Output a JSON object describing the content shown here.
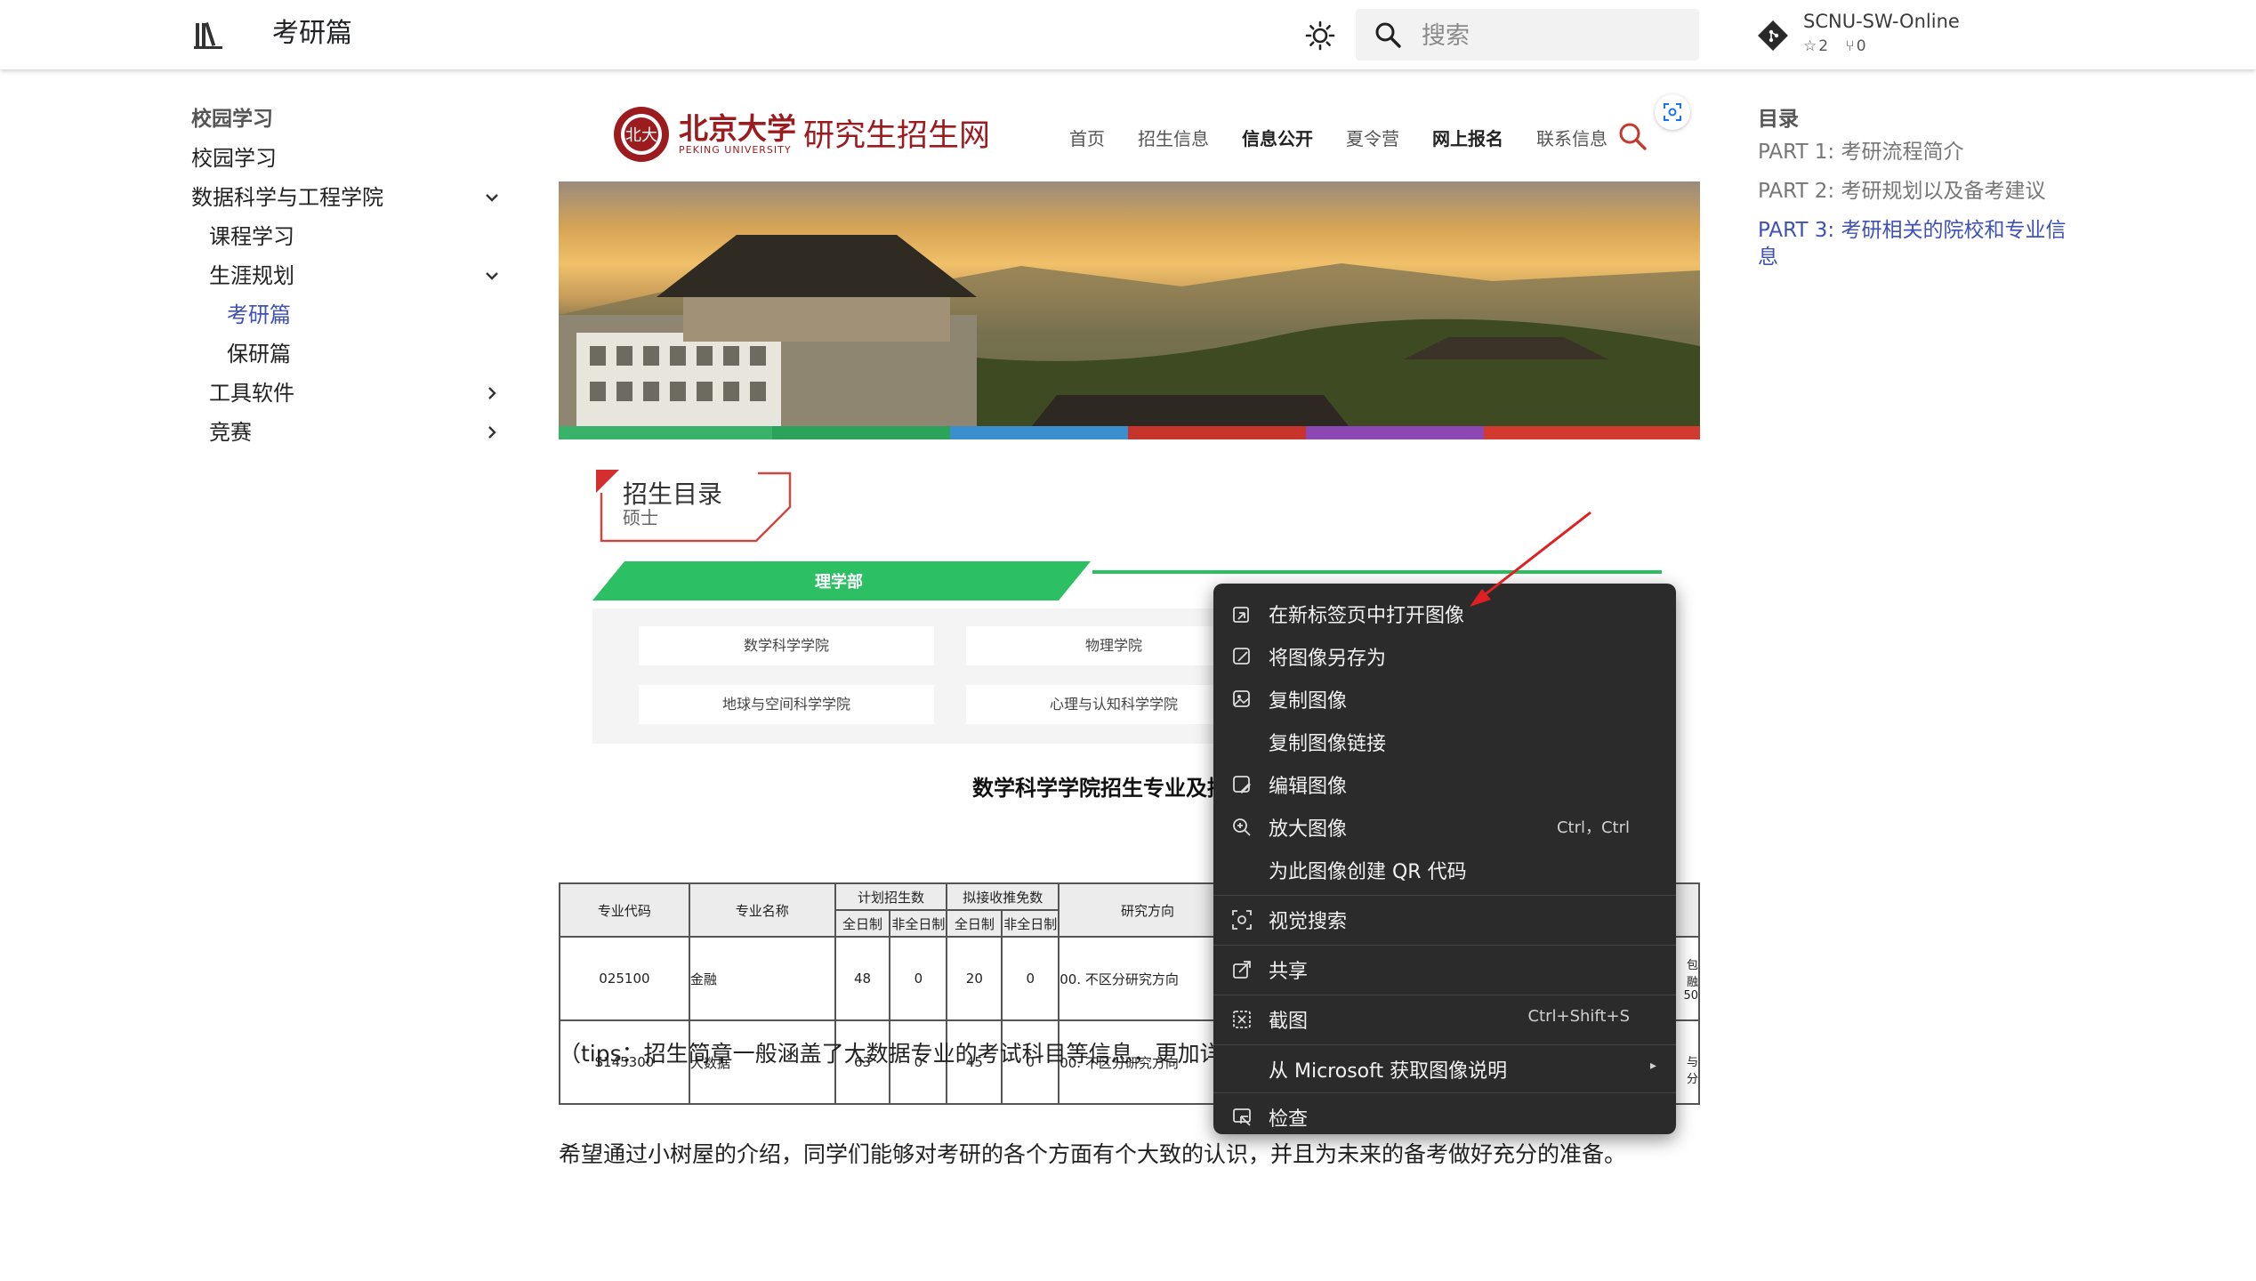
{
  "header": {
    "logo_icon": "library-books-icon",
    "title": "考研篇",
    "theme_icon": "brightness-icon",
    "search_icon": "magnify-icon",
    "search_placeholder": "搜索",
    "repo": {
      "icon": "git-diamond-icon",
      "name": "SCNU-SW-Online",
      "stars": "2",
      "forks": "0"
    }
  },
  "nav": {
    "heading": "校园学习",
    "items": [
      {
        "label": "校园学习"
      },
      {
        "label": "数据科学与工程学院"
      },
      {
        "label": "课程学习"
      },
      {
        "label": "生涯规划"
      },
      {
        "label": "考研篇"
      },
      {
        "label": "保研篇"
      },
      {
        "label": "工具软件"
      },
      {
        "label": "竞赛"
      }
    ]
  },
  "content": {
    "pku": {
      "name": "北京大学",
      "name_en": "PEKING UNIVERSITY",
      "site_title": "研究生招生网",
      "nav": [
        "首页",
        "招生信息",
        "信息公开",
        "夏令营",
        "网上报名",
        "联系信息"
      ]
    },
    "catalog": {
      "title": "招生目录",
      "subtitle": "硕士",
      "department": "理学部",
      "schools": [
        "数学科学学院",
        "物理学院",
        "地球与空间科学学院",
        "心理与认知科学学院"
      ]
    },
    "table": {
      "title": "数学科学学院招生专业及拟",
      "headers": [
        "专业代码",
        "专业名称",
        "计划招生数",
        "拟接收推免数",
        "研究方向"
      ],
      "subheaders": [
        "全日制",
        "非全日制",
        "全日制",
        "非全日制"
      ],
      "rows": [
        [
          "025100",
          "金融",
          "48",
          "0",
          "20",
          "0",
          "00. 不区分研究方向"
        ],
        [
          "S145300",
          "大数据",
          "63",
          "0",
          "45",
          "0",
          "00. 不区分研究方向"
        ]
      ],
      "edge_text_1": "包\n融\n50",
      "edge_text_2": "\n与\n分"
    },
    "tips": "（tips：招生简章一般涵盖了大数据专业的考试科目等信息，更加详细的信息可以搜集学长学姐们的上岸经验贴！）",
    "closing": "希望通过小树屋的介绍，同学们能够对考研的各个方面有个大致的认识，并且为未来的备考做好充分的准备。"
  },
  "context_menu": {
    "items": [
      {
        "label": "在新标签页中打开图像",
        "icon": "open-new-tab-icon"
      },
      {
        "label": "将图像另存为",
        "icon": "save-image-icon"
      },
      {
        "label": "复制图像",
        "icon": "copy-image-icon"
      },
      {
        "label": "复制图像链接",
        "icon": ""
      },
      {
        "label": "编辑图像",
        "icon": "edit-image-icon"
      },
      {
        "label": "放大图像",
        "icon": "zoom-in-icon",
        "shortcut": "Ctrl，Ctrl"
      },
      {
        "label": "为此图像创建 QR 代码",
        "icon": ""
      },
      {
        "label": "视觉搜索",
        "icon": "visual-search-icon"
      },
      {
        "label": "共享",
        "icon": "share-icon"
      },
      {
        "label": "截图",
        "icon": "screenshot-icon",
        "shortcut": "Ctrl+Shift+S"
      },
      {
        "label": "从 Microsoft 获取图像说明",
        "icon": "",
        "submenu": "▸"
      },
      {
        "label": "检查",
        "icon": "inspect-icon"
      }
    ]
  },
  "toc": {
    "heading": "目录",
    "items": [
      {
        "label": "PART 1: 考研流程简介"
      },
      {
        "label": "PART 2: 考研规划以及备考建议"
      },
      {
        "label": "PART 3: 考研相关的院校和专业信息"
      }
    ]
  },
  "colors": {
    "accent": "#3f51b5",
    "pku_red": "#9b1b1f",
    "dept_green": "#2dbf63",
    "menu_bg": "#2b2b2b"
  }
}
